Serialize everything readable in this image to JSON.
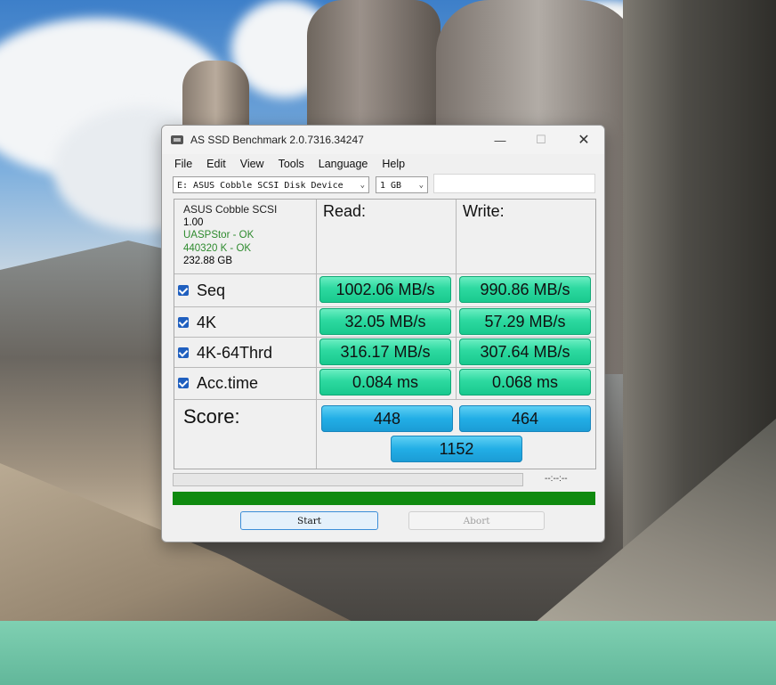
{
  "window": {
    "title": "AS SSD Benchmark 2.0.7316.34247"
  },
  "titlebar_buttons": {
    "minimize": "—",
    "maximize": "☐",
    "close": "✕"
  },
  "menu": [
    "File",
    "Edit",
    "View",
    "Tools",
    "Language",
    "Help"
  ],
  "drive_select": {
    "value": "E: ASUS Cobble SCSI Disk Device"
  },
  "size_select": {
    "value": "1 GB"
  },
  "device": {
    "name": "ASUS Cobble SCSI",
    "firmware": "1.00",
    "driver_status": "UASPStor - OK",
    "alignment_status": "440320 K - OK",
    "capacity": "232.88 GB"
  },
  "columns": {
    "read": "Read:",
    "write": "Write:"
  },
  "tests": [
    {
      "label": "Seq",
      "checked": true,
      "read": "1002.06 MB/s",
      "write": "990.86 MB/s"
    },
    {
      "label": "4K",
      "checked": true,
      "read": "32.05 MB/s",
      "write": "57.29 MB/s"
    },
    {
      "label": "4K-64Thrd",
      "checked": true,
      "read": "316.17 MB/s",
      "write": "307.64 MB/s"
    },
    {
      "label": "Acc.time",
      "checked": true,
      "read": "0.084 ms",
      "write": "0.068 ms"
    }
  ],
  "score": {
    "label": "Score:",
    "read": "448",
    "write": "464",
    "total": "1152"
  },
  "progress": {
    "timer": "--:--:--",
    "total_fill": 1.0
  },
  "buttons": {
    "start": "Start",
    "abort": "Abort"
  },
  "colors": {
    "result_green": "#2dd9a0",
    "score_blue": "#22aee6",
    "progress_green": "#0f8a0f",
    "ok_green": "#2e8b2e"
  }
}
